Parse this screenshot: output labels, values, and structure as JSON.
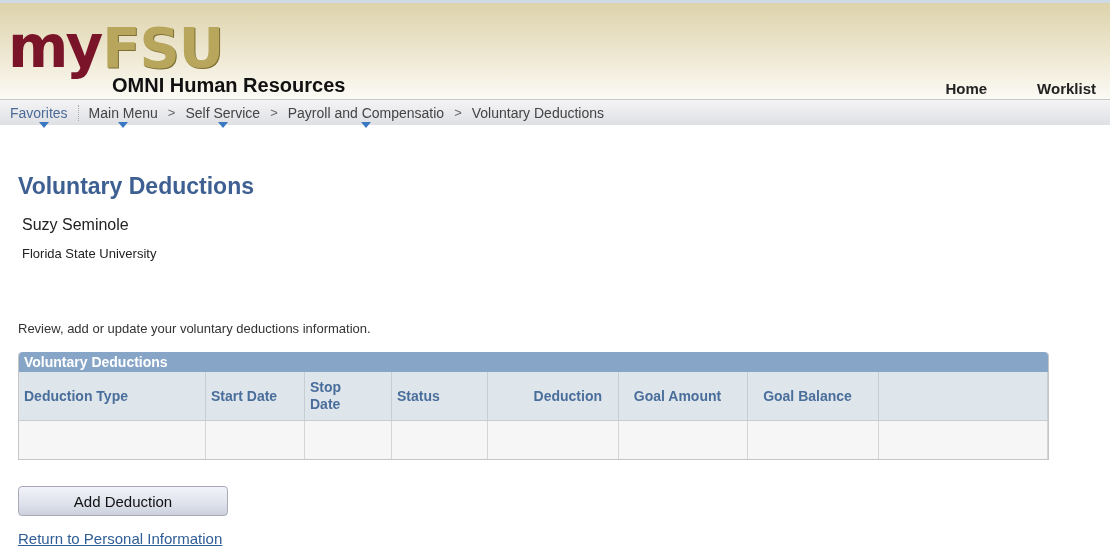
{
  "header": {
    "logo": {
      "part_1": "my",
      "part_2": "FSU"
    },
    "title": "OMNI Human Resources",
    "links": [
      "Home",
      "Worklist"
    ]
  },
  "breadcrumb": [
    {
      "label": "Favorites",
      "has_menu": true
    },
    {
      "label": "Main Menu",
      "has_menu": true
    },
    {
      "label": "Self Service",
      "has_menu": true,
      "separator": ">"
    },
    {
      "label": "Payroll and Compensatio",
      "has_menu": true,
      "separator": ">"
    },
    {
      "label": "Voluntary Deductions",
      "has_menu": false,
      "separator": ">"
    }
  ],
  "page_title": "Voluntary Deductions",
  "person": {
    "name": "Suzy Seminole",
    "organization": "Florida State University"
  },
  "instructions": "Review, add or update your voluntary deductions information.",
  "table": {
    "title": "Voluntary Deductions",
    "columns": [
      "Deduction Type",
      "Start Date",
      "Stop Date",
      "Status",
      "Deduction",
      "Goal Amount",
      "Goal Balance"
    ]
  },
  "buttons": [
    "Add Deduction"
  ],
  "link": "Return to Personal Information"
}
